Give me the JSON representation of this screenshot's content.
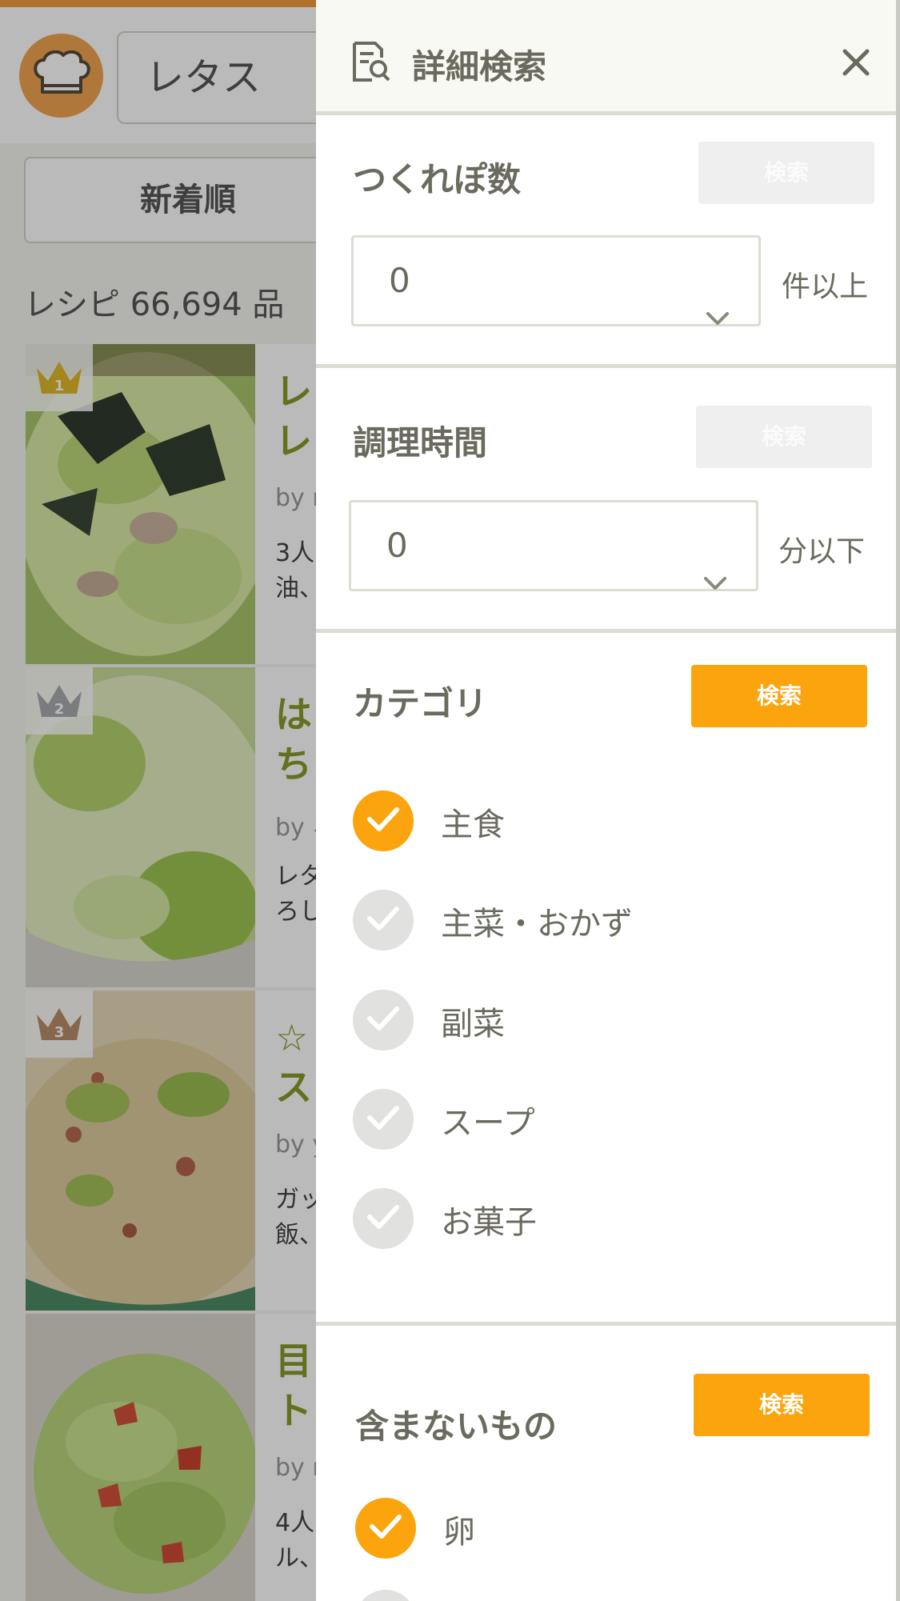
{
  "background": {
    "search_query": "レタス",
    "sort_label": "新着順",
    "recipe_count": "レシピ 66,694 品",
    "recipes": [
      {
        "rank": "1",
        "title": "レ\nレ",
        "author": "by r",
        "desc": "3人\n油、"
      },
      {
        "rank": "2",
        "title": "は\nち",
        "author": "by ネ",
        "desc": "レタ\nろし"
      },
      {
        "rank": "3",
        "title": "☆\nス",
        "author": "by y",
        "desc": "ガッ\n飯、"
      },
      {
        "rank": "",
        "title": "目\nト",
        "author": "by r",
        "desc": "4人\nル、"
      }
    ]
  },
  "drawer": {
    "title": "詳細検索",
    "tsukurepo": {
      "title": "つくれぽ数",
      "search_label": "検索",
      "value": "0",
      "unit": "件以上"
    },
    "cooking_time": {
      "title": "調理時間",
      "search_label": "検索",
      "value": "0",
      "unit": "分以下"
    },
    "category": {
      "title": "カテゴリ",
      "search_label": "検索",
      "options": [
        {
          "label": "主食",
          "checked": true
        },
        {
          "label": "主菜・おかず",
          "checked": false
        },
        {
          "label": "副菜",
          "checked": false
        },
        {
          "label": "スープ",
          "checked": false
        },
        {
          "label": "お菓子",
          "checked": false
        }
      ]
    },
    "exclude": {
      "title": "含まないもの",
      "search_label": "検索",
      "options": [
        {
          "label": "卵",
          "checked": true
        }
      ]
    }
  },
  "colors": {
    "accent": "#fba40d",
    "disabled_button": "#efefef",
    "unchecked": "#e1e1df",
    "text": "#6b6a5e",
    "title_green": "#8a9a2a"
  }
}
